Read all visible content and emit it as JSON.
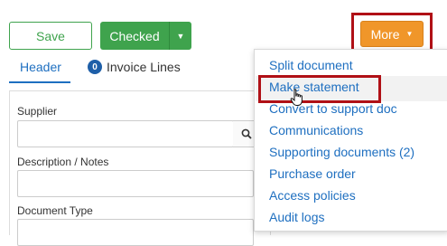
{
  "toolbar": {
    "save_label": "Save",
    "checked_label": "Checked",
    "checked_dropdown_icon": "caret-down",
    "more_label": "More",
    "more_dropdown_icon": "caret-down"
  },
  "tabs": {
    "header_label": "Header",
    "invoice_lines_count": "0",
    "invoice_lines_label": "Invoice Lines"
  },
  "form": {
    "supplier_label": "Supplier",
    "supplier_value": "",
    "supplier_search_icon": "search-icon",
    "description_label": "Description / Notes",
    "description_value": "",
    "document_type_label": "Document Type"
  },
  "more_menu": {
    "items": [
      "Split document",
      "Make statement",
      "Convert to support doc",
      "Communications",
      "Supporting documents (2)",
      "Purchase order",
      "Access policies",
      "Audit logs"
    ],
    "hovered_index": 1
  },
  "colors": {
    "green": "#3fa34d",
    "orange": "#f0962a",
    "link_blue": "#1e6fc0",
    "highlight_red": "#b01016"
  }
}
